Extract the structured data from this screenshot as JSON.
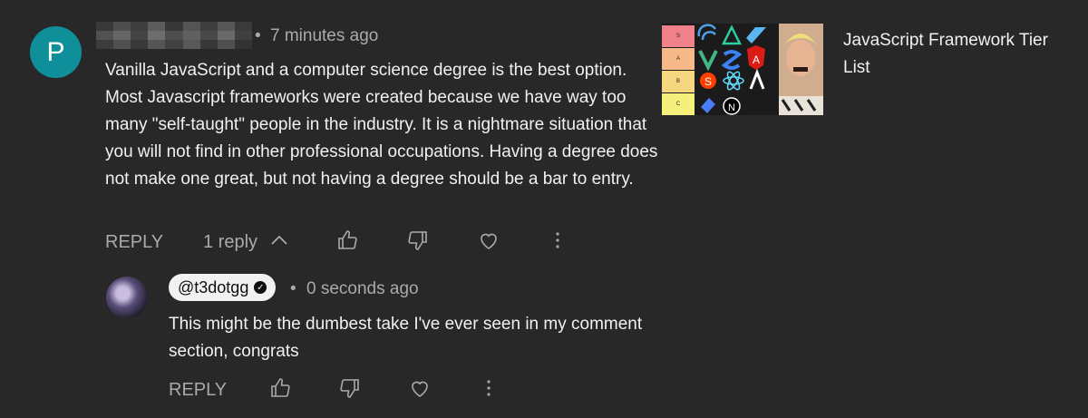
{
  "comment": {
    "avatar_letter": "P",
    "timestamp": "7 minutes ago",
    "text": "Vanilla JavaScript and a computer science degree is the best option. Most Javascript frameworks were created because we have way too many \"self-taught\" people in the industry. It is a nightmare situation that you will not find in other professional occupations. Having a degree does not make one great, but not having a degree should be a bar to entry.",
    "reply_label": "REPLY",
    "replies_toggle": "1 reply",
    "avatar_color": "#0f8f9a"
  },
  "reply": {
    "author": "@t3dotgg",
    "timestamp": "0 seconds ago",
    "text": "This might be the dumbest take I've ever seen in my comment section, congrats",
    "reply_label": "REPLY"
  },
  "video": {
    "title": "JavaScript Framework Tier List",
    "tiers": [
      "S",
      "A",
      "B",
      "C"
    ],
    "tier_colors": [
      "#f0808a",
      "#f7b98a",
      "#f6d67f",
      "#f4f07b"
    ]
  },
  "separator": "•",
  "icons": [
    "thumbs-up-icon",
    "thumbs-down-icon",
    "heart-icon",
    "more-vert-icon",
    "chevron-up-icon",
    "verified-check-icon"
  ]
}
